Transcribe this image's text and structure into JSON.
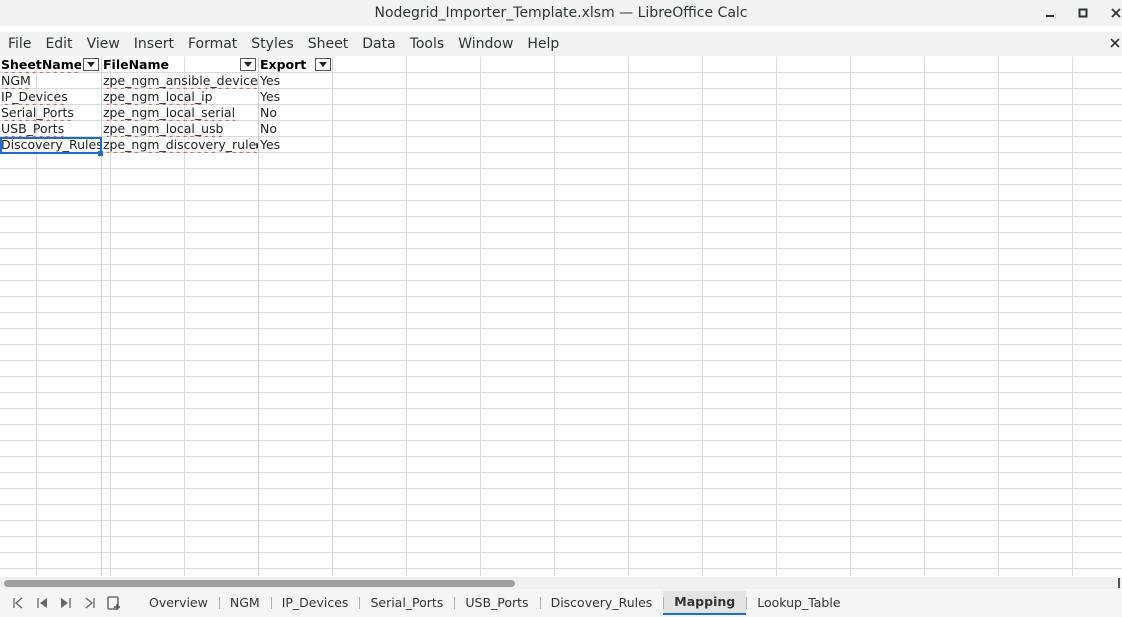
{
  "window": {
    "title": "Nodegrid_Importer_Template.xlsm — LibreOffice Calc",
    "minimize_glyph": "🗕",
    "maximize_glyph": "□",
    "close_glyph": "✕"
  },
  "menubar": {
    "items": [
      "File",
      "Edit",
      "View",
      "Insert",
      "Format",
      "Styles",
      "Sheet",
      "Data",
      "Tools",
      "Window",
      "Help"
    ],
    "close_glyph": "✕"
  },
  "sheet": {
    "headers": [
      "SheetName",
      "FileName",
      "Export"
    ],
    "rows": [
      [
        "NGM",
        "zpe_ngm_ansible_device▸",
        "Yes"
      ],
      [
        "IP_Devices",
        "zpe_ngm_local_ip",
        "Yes"
      ],
      [
        "Serial_Ports",
        "zpe_ngm_local_serial",
        "No"
      ],
      [
        "USB_Ports",
        "zpe_ngm_local_usb",
        "No"
      ],
      [
        "Discovery_Rules",
        "zpe_ngm_discovery_rule▸",
        "Yes"
      ]
    ],
    "selected_cell": "A6"
  },
  "tabbar": {
    "nav": [
      "first-sheet-icon",
      "previous-sheet-icon",
      "next-sheet-icon",
      "last-sheet-icon",
      "add-sheet-icon"
    ],
    "tabs": [
      "Overview",
      "NGM",
      "IP_Devices",
      "Serial_Ports",
      "USB_Ports",
      "Discovery_Rules",
      "Mapping",
      "Lookup_Table"
    ],
    "active_tab": "Mapping"
  },
  "colors": {
    "accent": "#1e6bd6",
    "gridline": "#dadada",
    "spellcheck_underline": "#d9534f"
  }
}
